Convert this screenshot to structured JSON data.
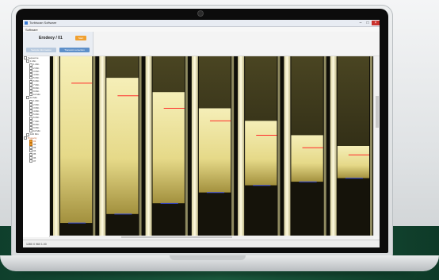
{
  "window": {
    "title": "Turbiscan Software",
    "menu": "Software"
  },
  "header": {
    "sample_title": "Erodeoy / 01",
    "orange_button": "Start",
    "grey_button": "Sample information",
    "blue_button": "Transmit correction"
  },
  "tree": [
    {
      "level": 0,
      "label": "Sequence",
      "hl": false
    },
    {
      "level": 1,
      "label": "1 Min",
      "hl": false
    },
    {
      "level": 2,
      "label": "1 Min",
      "hl": false
    },
    {
      "level": 2,
      "label": "2 Min",
      "hl": false
    },
    {
      "level": 2,
      "label": "3 Min",
      "hl": false
    },
    {
      "level": 2,
      "label": "4 Min",
      "hl": false
    },
    {
      "level": 2,
      "label": "5 Min",
      "hl": false
    },
    {
      "level": 2,
      "label": "6 Min",
      "hl": false
    },
    {
      "level": 2,
      "label": "7 Min",
      "hl": false
    },
    {
      "level": 2,
      "label": "8 Min",
      "hl": false
    },
    {
      "level": 2,
      "label": "9 Min",
      "hl": false
    },
    {
      "level": 2,
      "label": "10 Min",
      "hl": false
    },
    {
      "level": 1,
      "label": "10 Min",
      "hl": false
    },
    {
      "level": 2,
      "label": "1 Min",
      "hl": false
    },
    {
      "level": 2,
      "label": "2 Min",
      "hl": false
    },
    {
      "level": 2,
      "label": "3 Min",
      "hl": false
    },
    {
      "level": 2,
      "label": "4 Min",
      "hl": false
    },
    {
      "level": 2,
      "label": "5 Min",
      "hl": false
    },
    {
      "level": 2,
      "label": "6 Min",
      "hl": false
    },
    {
      "level": 2,
      "label": "7 Min",
      "hl": false
    },
    {
      "level": 2,
      "label": "8 Min",
      "hl": false
    },
    {
      "level": 2,
      "label": "9 Min",
      "hl": false
    },
    {
      "level": 2,
      "label": "10 Min",
      "hl": false
    },
    {
      "level": 1,
      "label": "100 Min",
      "hl": false
    },
    {
      "level": 0,
      "label": "Property",
      "hl": true
    },
    {
      "level": 2,
      "label": "01",
      "hl": true,
      "orange": true
    },
    {
      "level": 2,
      "label": "02",
      "hl": false,
      "orange": true
    },
    {
      "level": 2,
      "label": "03",
      "hl": false
    },
    {
      "level": 2,
      "label": "04",
      "hl": false
    },
    {
      "level": 2,
      "label": "05",
      "hl": false
    },
    {
      "level": 2,
      "label": "06",
      "hl": false
    },
    {
      "level": 2,
      "label": "07",
      "hl": false
    }
  ],
  "status": {
    "text": "1280 X 960 1.00"
  },
  "images": {
    "tube_count": 7,
    "tubes": [
      {
        "red_line": 0.15,
        "blue_line": 0.93,
        "top_level": 0.0
      },
      {
        "red_line": 0.22,
        "blue_line": 0.88,
        "top_level": 0.12
      },
      {
        "red_line": 0.29,
        "blue_line": 0.82,
        "top_level": 0.2
      },
      {
        "red_line": 0.36,
        "blue_line": 0.76,
        "top_level": 0.29
      },
      {
        "red_line": 0.44,
        "blue_line": 0.72,
        "top_level": 0.36
      },
      {
        "red_line": 0.51,
        "blue_line": 0.7,
        "top_level": 0.44
      },
      {
        "red_line": 0.55,
        "blue_line": 0.68,
        "top_level": 0.5
      }
    ]
  },
  "colors": {
    "accent_orange": "#f0a030",
    "button_blue": "#5d8fc9",
    "red_marker": "#ff2a2a",
    "blue_marker": "#3a4cd8",
    "tube_glow": "#fff5b0"
  }
}
